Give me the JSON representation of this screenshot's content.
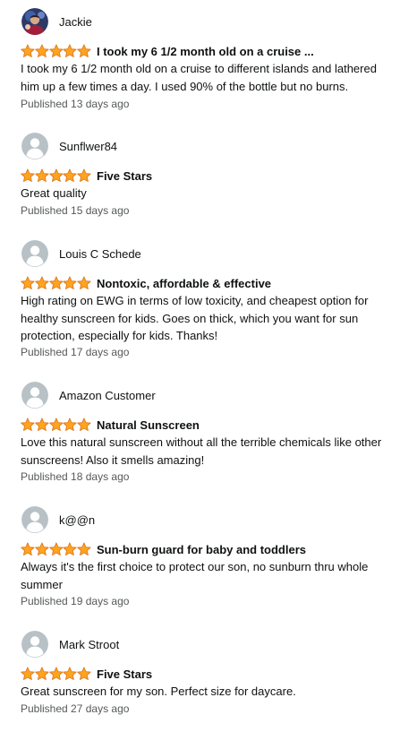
{
  "reviews": [
    {
      "author": "Jackie",
      "avatar": "profile-photo",
      "rating": 5,
      "title": "I took my 6 1/2 month old on a cruise ...",
      "body": "I took my 6 1/2 month old on a cruise to different islands and lathered him up a few times a day. I used 90% of the bottle but no burns.",
      "published": "Published 13 days ago"
    },
    {
      "author": "Sunflwer84",
      "avatar": "default-user-icon",
      "rating": 5,
      "title": "Five Stars",
      "body": "Great quality",
      "published": "Published 15 days ago"
    },
    {
      "author": "Louis C Schede",
      "avatar": "default-user-icon",
      "rating": 5,
      "title": "Nontoxic, affordable & effective",
      "body": "High rating on EWG in terms of low toxicity, and cheapest option for healthy sunscreen for kids. Goes on thick, which you want for sun protection, especially for kids. Thanks!",
      "published": "Published 17 days ago"
    },
    {
      "author": "Amazon Customer",
      "avatar": "default-user-icon",
      "rating": 5,
      "title": "Natural Sunscreen",
      "body": "Love this natural sunscreen without all the terrible chemicals like other sunscreens! Also it smells amazing!",
      "published": "Published 18 days ago"
    },
    {
      "author": "k@@n",
      "avatar": "default-user-icon",
      "rating": 5,
      "title": "Sun-burn guard for baby and toddlers",
      "body": "Always it's the first choice to protect our son, no sunburn thru whole summer",
      "published": "Published 19 days ago"
    },
    {
      "author": "Mark Stroot",
      "avatar": "default-user-icon",
      "rating": 5,
      "title": "Five Stars",
      "body": "Great sunscreen for my son. Perfect size for daycare.",
      "published": "Published 27 days ago"
    }
  ],
  "colors": {
    "star": "#ffa41c",
    "star_outline": "#de7921",
    "text": "#0f1111",
    "muted": "#565959",
    "avatar_bg": "#b7c1c6"
  }
}
